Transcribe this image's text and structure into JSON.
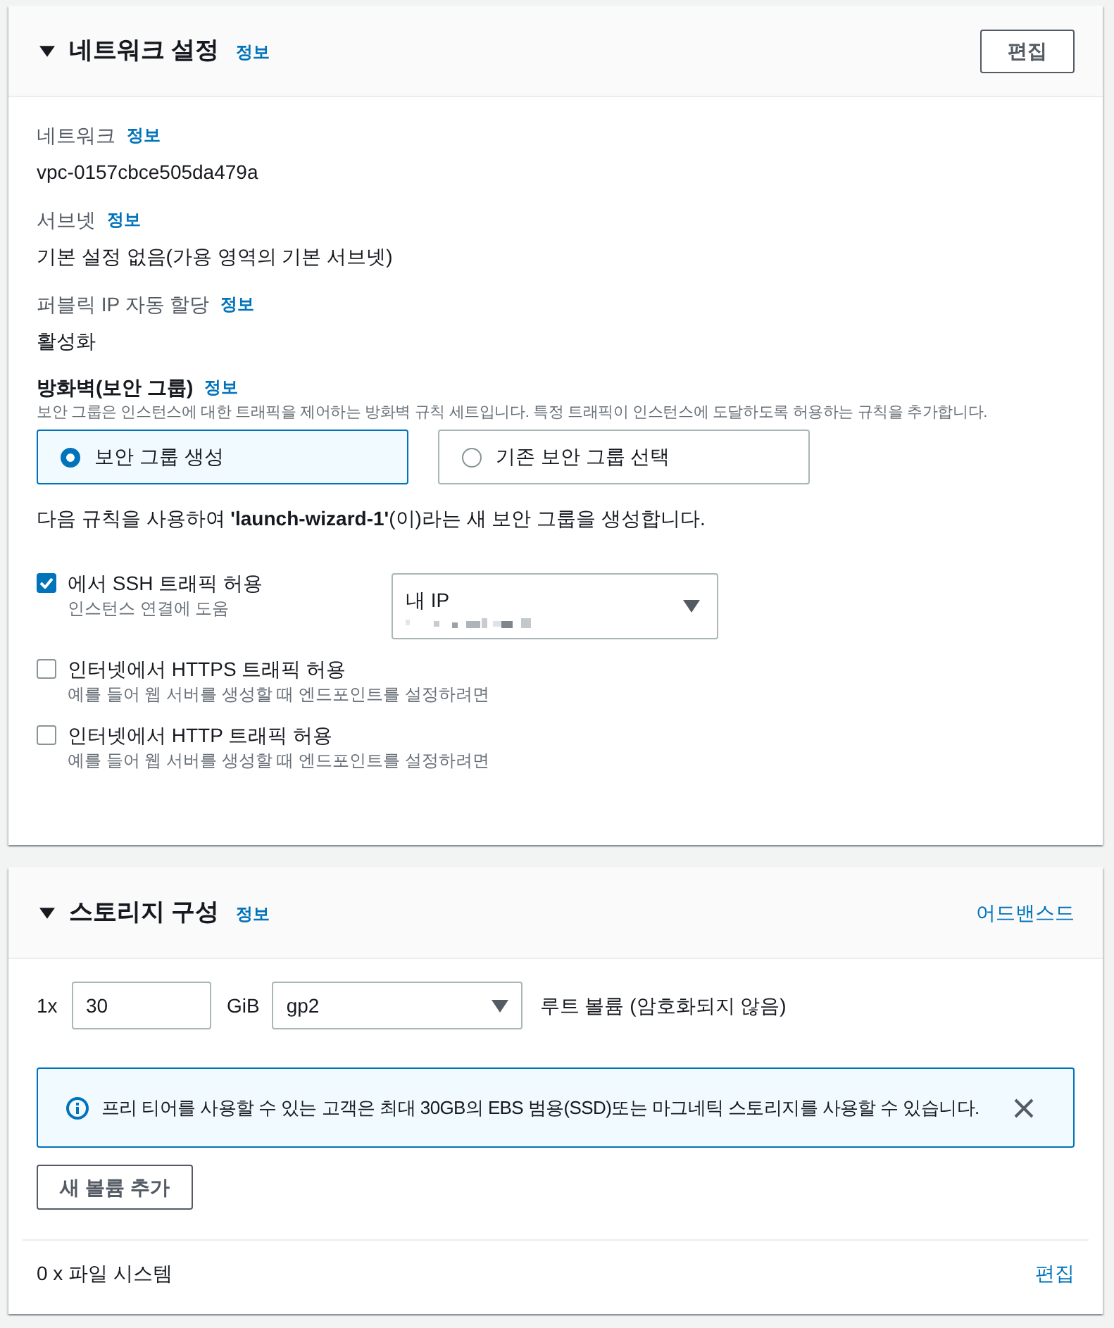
{
  "network_settings": {
    "title": "네트워크 설정",
    "info_link": "정보",
    "expanded": true,
    "edit_button": "편집",
    "fields": [
      {
        "label": "네트워크",
        "info_link": "정보",
        "value": "vpc-0157cbce505da479a"
      },
      {
        "label": "서브넷",
        "info_link": "정보",
        "value": "기본 설정 없음(가용 영역의 기본 서브넷)"
      },
      {
        "label": "퍼블릭 IP 자동 할당",
        "info_link": "정보",
        "value": "활성화"
      }
    ],
    "firewall": {
      "label": "방화벽(보안 그룹)",
      "info_link": "정보",
      "description": "보안 그룹은 인스턴스에 대한 트래픽을 제어하는 방화벽 규칙 세트입니다. 특정 트래픽이 인스턴스에 도달하도록 허용하는 규칙을 추가합니다.",
      "options": [
        {
          "label": "보안 그룹 생성",
          "selected": true
        },
        {
          "label": "기존 보안 그룹 선택",
          "selected": false
        }
      ],
      "summary": "다음 규칙을 사용하여 **'launch-wizard-1'**(이)라는 새 보안 그룹을 생성합니다.",
      "rules": [
        {
          "label": "에서 SSH 트래픽 허용",
          "hint": "인스턴스 연결에 도움",
          "checked": true,
          "source": {
            "value": "내 IP"
          }
        },
        {
          "label": "인터넷에서 HTTPS 트래픽 허용",
          "hint": "예를 들어 웹 서버를 생성할 때 엔드포인트를 설정하려면",
          "checked": false
        },
        {
          "label": "인터넷에서 HTTP 트래픽 허용",
          "hint": "예를 들어 웹 서버를 생성할 때 엔드포인트를 설정하려면",
          "checked": false
        }
      ]
    }
  },
  "storage": {
    "title": "스토리지 구성",
    "info_link": "정보",
    "expanded": true,
    "advanced_link": "어드밴스드",
    "volumes": [
      {
        "count": "1x",
        "size": "30",
        "unit": "GiB",
        "type": "gp2",
        "note": "루트 볼륨 (암호화되지 않음)"
      }
    ],
    "alert": {
      "text": "프리 티어를 사용할 수 있는 고객은 최대 30GB의 EBS 범용(SSD)또는 마그네틱 스토리지를 사용할 수 있습니다."
    },
    "add_button": "새 볼륨 추가",
    "file_systems": {
      "text": "0 x 파일 시스템",
      "edit_link": "편집"
    }
  }
}
